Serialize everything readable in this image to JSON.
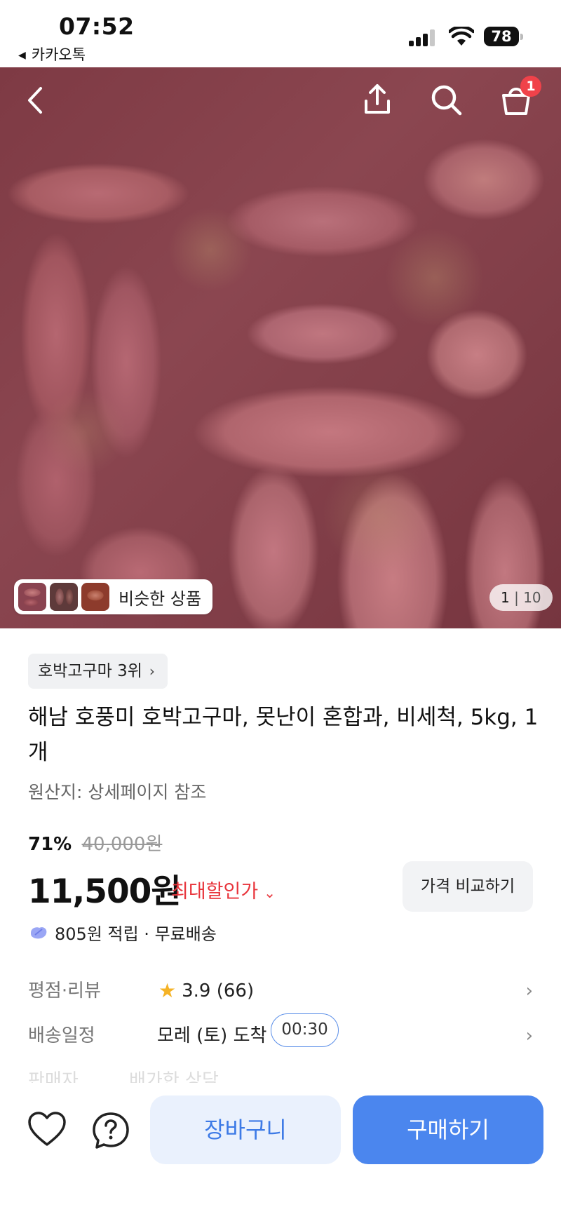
{
  "status_bar": {
    "time": "07:52",
    "back_app": "카카오톡",
    "battery": "78"
  },
  "header": {
    "cart_count": "1",
    "icons": [
      "back-icon",
      "share-icon",
      "search-icon",
      "cart-icon"
    ]
  },
  "gallery": {
    "similar_label": "비슷한 상품",
    "page_current": "1",
    "page_total": "10"
  },
  "product": {
    "rank_label": "호박고구마 3위",
    "title": "해남 호풍미 호박고구마, 못난이 혼합과, 비세척, 5kg, 1개",
    "origin": "원산지: 상세페이지 참조",
    "discount_pct": "71%",
    "original_price": "40,000원",
    "price": "11,500원",
    "max_discount_label": "최대할인가",
    "compare_label": "가격 비교하기",
    "points_text": "805원 적립 · 무료배송"
  },
  "details": {
    "rating_label": "평점·리뷰",
    "rating_value": "3.9 (66)",
    "delivery_label": "배송일정",
    "delivery_value": "모레 (토) 도착",
    "delivery_timer": "00:30",
    "faded_label": "판매자",
    "faded_value": "배가한 상담"
  },
  "actions": {
    "cart_label": "장바구니",
    "buy_label": "구매하기"
  },
  "colors": {
    "accent": "#4b86ee",
    "discount_red": "#e8343b",
    "badge_red": "#f0424a",
    "star": "#f5b326"
  }
}
